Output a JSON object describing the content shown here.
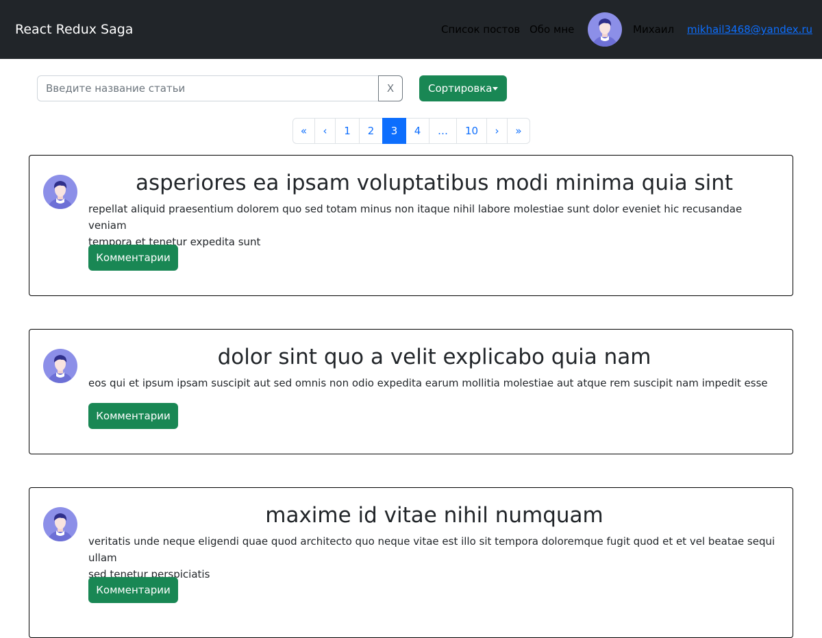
{
  "navbar": {
    "brand": "React Redux Saga",
    "links": [
      {
        "label": "Список постов"
      },
      {
        "label": "Обо мне"
      }
    ],
    "user": {
      "name": "Михаил",
      "email": "mikhail3468@yandex.ru",
      "avatar_icon": "user-avatar-icon"
    }
  },
  "search": {
    "placeholder": "Введите название статьи",
    "value": "",
    "clear_label": "X"
  },
  "sort": {
    "label": "Сортировка"
  },
  "pagination": {
    "first": "«",
    "prev": "‹",
    "pages": [
      "1",
      "2",
      "3",
      "4",
      "…",
      "10"
    ],
    "active": "3",
    "next": "›",
    "last": "»"
  },
  "posts": [
    {
      "title": "asperiores ea ipsam voluptatibus modi minima quia sint",
      "body_lines": [
        "repellat aliquid praesentium dolorem quo sed totam minus non itaque nihil labore molestiae sunt dolor eveniet hic recusandae veniam",
        "tempora et tenetur expedita sunt"
      ],
      "button": "Комментарии"
    },
    {
      "title": "dolor sint quo a velit explicabo quia nam",
      "body_lines": [
        "eos qui et ipsum ipsam suscipit aut sed omnis non odio expedita earum mollitia molestiae aut atque rem suscipit nam impedit esse"
      ],
      "button": "Комментарии"
    },
    {
      "title": "maxime id vitae nihil numquam",
      "body_lines": [
        "veritatis unde neque eligendi quae quod architecto quo neque vitae est illo sit tempora doloremque fugit quod et et vel beatae sequi ullam",
        "sed tenetur perspiciatis"
      ],
      "button": "Комментарии"
    }
  ],
  "colors": {
    "navbar_bg": "#212529",
    "accent_green": "#198754",
    "primary_blue": "#0d6efd",
    "avatar_bg": "#8c8fe8"
  }
}
